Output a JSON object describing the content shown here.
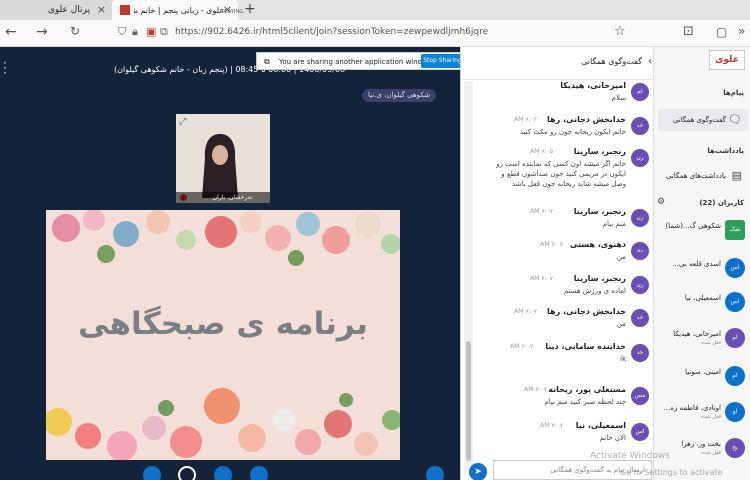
{
  "browser": {
    "tab1_title": "پرتال علوی",
    "tab2_title": "علوی - زبانی پنجم | خانم شکوهی",
    "tab2_status": "PLAYING",
    "url": "https://902.6426.ir/html5client/join?sessionToken=zewpewdljmh6jqre"
  },
  "session": {
    "info": "(پنجم زبان - خانم شکوهی گیلوان) | 1400/09/08 | 08:00 تا 08:45",
    "chip": "شکوهی گیلوان، ی.نیا",
    "webcam_name": "تدرخشان، باران",
    "slide_title": "برنامه ی صبحگاهی"
  },
  "sharing": {
    "message": "You are sharing another application window.",
    "stop_label": "Stop Sharing",
    "hide_label": "_"
  },
  "chat": {
    "header": "گفت‌وگوی همگانی",
    "input_placeholder": "ارسال پیام به گفت‌وگوی همگانی",
    "messages": [
      {
        "avatar": "ام",
        "name": "امیرخانی، هیدیکا",
        "time": "",
        "text": "سلام"
      },
      {
        "avatar": "خد",
        "name": "خدابخش دجانی، رها",
        "time": "۷:۰۲ AM",
        "text": "خانم ایکون ریحانه جون رو مکث کنید"
      },
      {
        "avatar": "رن",
        "name": "رنجبر، سارینا",
        "time": "۷:۰۵ AM",
        "text": "خانم اگر میشه اون کسی که نماینده است رو ایکون در مریمی کنید جون صداشون قطع و وصل میشه شاید ریحانه جون قفل باشد"
      },
      {
        "avatar": "رن",
        "name": "رنجبر، سارینا",
        "time": "۷:۰۷ AM",
        "text": "منم بیام"
      },
      {
        "avatar": "ده",
        "name": "دهنوی، هستی",
        "time": "۷:۰۷ AM",
        "text": "من"
      },
      {
        "avatar": "رن",
        "name": "رنجبر، سارینا",
        "time": "۷:۰۷ AM",
        "text": "اماده ی ورزش هستم"
      },
      {
        "avatar": "خد",
        "name": "خدابخش دجانی، رها",
        "time": "۷:۰۷ AM",
        "text": "من"
      },
      {
        "avatar": "خد",
        "name": "خداینده سامانی، دینا",
        "time": "۷:۰۷ AM",
        "text": "ik"
      },
      {
        "avatar": "مس",
        "name": "مسنعلی پور، ریحانه",
        "time": "۷:۰۷ AM",
        "text": "چند لحظه صبر کنید منم بیام"
      },
      {
        "avatar": "اس",
        "name": "اسمعیلی، نیا",
        "time": "۷:۰۷ AM",
        "text": "الان خانم"
      }
    ]
  },
  "sidebar": {
    "logo": "علوی",
    "messages_section": "پیام‌ها",
    "public_chat": "گفت‌وگوی همگانی",
    "notes_section": "یادداشت‌ها",
    "shared_notes": "یادداشت‌های همگانی",
    "users_section": "کاربران (22)",
    "users": [
      {
        "avatar": "شک",
        "name": "شکوهی گ...(شما)",
        "status": ""
      },
      {
        "avatar": "اس",
        "name": "اسدی قلعه بی...",
        "status": ""
      },
      {
        "avatar": "اس",
        "name": "اسمعیلی، نیا",
        "status": ""
      },
      {
        "avatar": "ام",
        "name": "امیرخانی، هیدیکا",
        "status": "قفل شده"
      },
      {
        "avatar": "ام",
        "name": "امینی، سونیا",
        "status": ""
      },
      {
        "avatar": "او",
        "name": "اوتادی، فاطمه زه...",
        "status": "قفل شده"
      },
      {
        "avatar": "بخ",
        "name": "بخت ور، زهرا",
        "status": "قفل شده"
      }
    ]
  },
  "watermark": {
    "title": "Activate Windows",
    "subtitle": "Go to Settings to activate"
  },
  "colors": {
    "dark_bg": "#13233a",
    "accent": "#0f70c9",
    "avatar_purple": "#6a4fb3"
  }
}
